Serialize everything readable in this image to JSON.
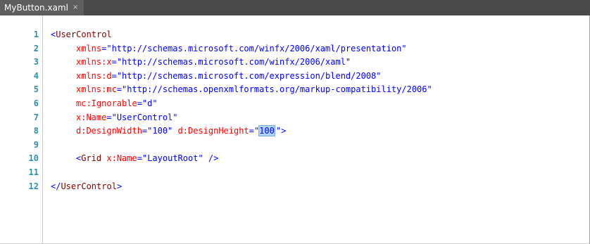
{
  "tab": {
    "title": "MyButton.xaml",
    "close_glyph": "×"
  },
  "editor": {
    "line_numbers": [
      "1",
      "2",
      "3",
      "4",
      "5",
      "6",
      "7",
      "8",
      "9",
      "10",
      "11",
      "12"
    ],
    "lines": [
      {
        "open": "<",
        "tag": "UserControl",
        "close": ""
      },
      {
        "attr": "xmlns",
        "eq": "=",
        "value": "\"http://schemas.microsoft.com/winfx/2006/xaml/presentation\""
      },
      {
        "attr": "xmlns:x",
        "eq": "=",
        "value": "\"http://schemas.microsoft.com/winfx/2006/xaml\""
      },
      {
        "attr": "xmlns:d",
        "eq": "=",
        "value": "\"http://schemas.microsoft.com/expression/blend/2008\""
      },
      {
        "attr": "xmlns:mc",
        "eq": "=",
        "value": "\"http://schemas.openxmlformats.org/markup-compatibility/2006\""
      },
      {
        "attr": "mc:Ignorable",
        "eq": "=",
        "value": "\"d\""
      },
      {
        "attr": "x:Name",
        "eq": "=",
        "value": "\"UserControl\""
      },
      {
        "attr1": "d:DesignWidth",
        "eq1": "=",
        "value1": "\"100\"",
        "attr2": "d:DesignHeight",
        "eq2": "=",
        "quote_open": "\"",
        "selected": "100",
        "quote_close": "\"",
        "end": ">"
      },
      {},
      {
        "open": "<",
        "tag": "Grid",
        "attr": "x:Name",
        "eq": "=",
        "value": "\"LayoutRoot\"",
        "close": " />"
      },
      {},
      {
        "open": "</",
        "tag": "UserControl",
        "close": ">"
      }
    ]
  },
  "colors": {
    "tab_bar": "#4a4a4a",
    "tab_active": "#5e5e5e",
    "line_number": "#2b91af",
    "tag": "#800000",
    "attribute": "#ff0000",
    "value": "#0000ff",
    "selection": "#add6ff"
  }
}
